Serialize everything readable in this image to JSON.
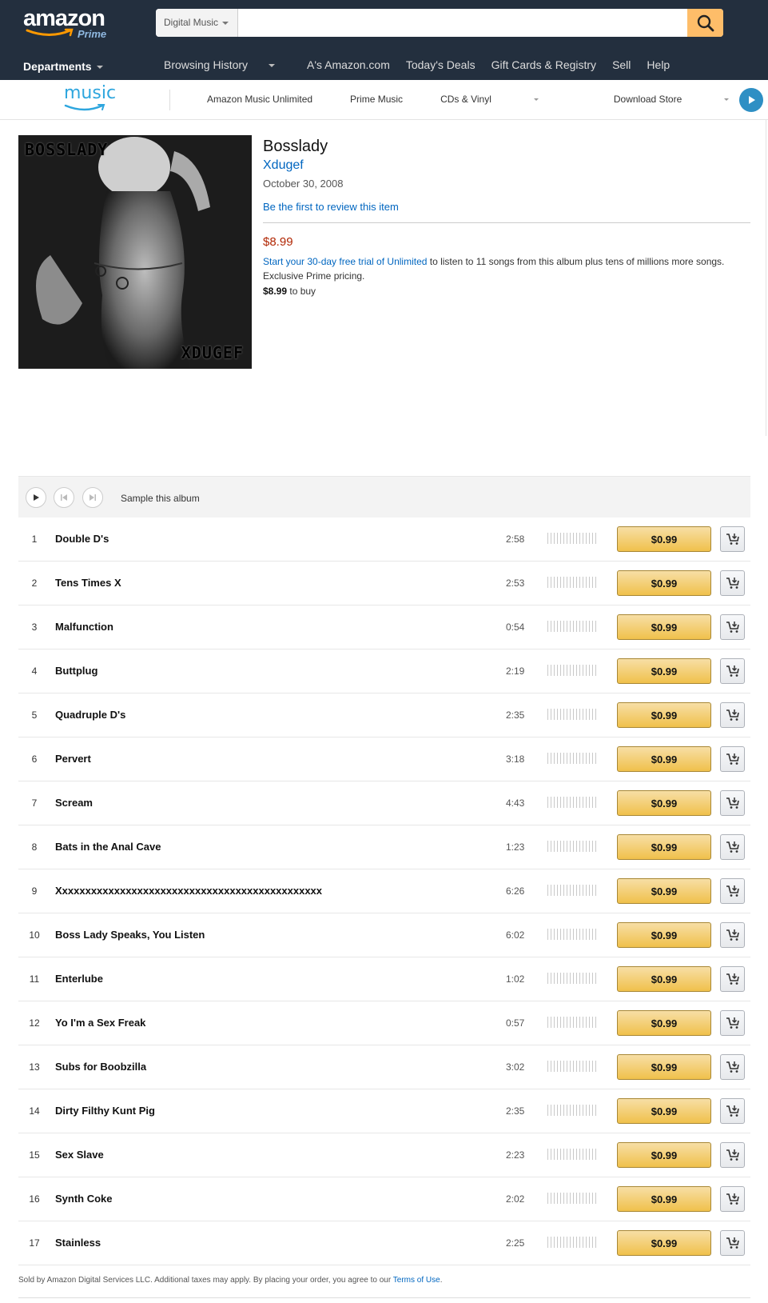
{
  "header": {
    "logo_text": "amazon",
    "logo_sub": "Prime",
    "search_category": "Digital Music",
    "search_placeholder": "",
    "departments_label": "Departments",
    "nav_links": [
      "Browsing History",
      "A's Amazon.com",
      "Today's Deals",
      "Gift Cards & Registry",
      "Sell",
      "Help"
    ]
  },
  "music_nav": {
    "logo_text": "music",
    "tabs": [
      "Amazon Music Unlimited",
      "Prime Music",
      "CDs & Vinyl",
      "Download Store"
    ]
  },
  "album": {
    "cover_title": "BOSSLADY",
    "cover_artist": "XDUGEF",
    "title": "Bosslady",
    "artist": "Xdugef",
    "release_date": "October 30, 2008",
    "review_link": "Be the first to review this item",
    "price": "$8.99",
    "unlimited_link": "Start your 30-day free trial of Unlimited",
    "unlimited_text": " to listen to 11 songs from this album plus tens of millions more songs.",
    "prime_note": "Exclusive Prime pricing.",
    "buy_price": "$8.99",
    "buy_text": " to buy"
  },
  "sampler": {
    "label": "Sample this album"
  },
  "tracks": [
    {
      "num": "1",
      "name": "Double D's",
      "duration": "2:58",
      "price": "$0.99"
    },
    {
      "num": "2",
      "name": "Tens Times X",
      "duration": "2:53",
      "price": "$0.99"
    },
    {
      "num": "3",
      "name": "Malfunction",
      "duration": "0:54",
      "price": "$0.99"
    },
    {
      "num": "4",
      "name": "Buttplug",
      "duration": "2:19",
      "price": "$0.99"
    },
    {
      "num": "5",
      "name": "Quadruple D's",
      "duration": "2:35",
      "price": "$0.99"
    },
    {
      "num": "6",
      "name": "Pervert",
      "duration": "3:18",
      "price": "$0.99"
    },
    {
      "num": "7",
      "name": "Scream",
      "duration": "4:43",
      "price": "$0.99"
    },
    {
      "num": "8",
      "name": "Bats in the Anal Cave",
      "duration": "1:23",
      "price": "$0.99"
    },
    {
      "num": "9",
      "name": "Xxxxxxxxxxxxxxxxxxxxxxxxxxxxxxxxxxxxxxxxxxxxxx",
      "duration": "6:26",
      "price": "$0.99"
    },
    {
      "num": "10",
      "name": "Boss Lady Speaks, You Listen",
      "duration": "6:02",
      "price": "$0.99"
    },
    {
      "num": "11",
      "name": "Enterlube",
      "duration": "1:02",
      "price": "$0.99"
    },
    {
      "num": "12",
      "name": "Yo I'm a Sex Freak",
      "duration": "0:57",
      "price": "$0.99"
    },
    {
      "num": "13",
      "name": "Subs for Boobzilla",
      "duration": "3:02",
      "price": "$0.99"
    },
    {
      "num": "14",
      "name": "Dirty Filthy Kunt Pig",
      "duration": "2:35",
      "price": "$0.99"
    },
    {
      "num": "15",
      "name": "Sex Slave",
      "duration": "2:23",
      "price": "$0.99"
    },
    {
      "num": "16",
      "name": "Synth Coke",
      "duration": "2:02",
      "price": "$0.99"
    },
    {
      "num": "17",
      "name": "Stainless",
      "duration": "2:25",
      "price": "$0.99"
    }
  ],
  "footer": {
    "text": "Sold by Amazon Digital Services LLC. Additional taxes may apply. By placing your order, you agree to our ",
    "terms_link": "Terms of Use",
    "end": "."
  },
  "colors": {
    "header_bg": "#232f3e",
    "link": "#0066c0",
    "price_red": "#b12704",
    "button_gold": "#f0c14b",
    "search_button": "#febd69",
    "music_blue": "#2ea6de"
  }
}
